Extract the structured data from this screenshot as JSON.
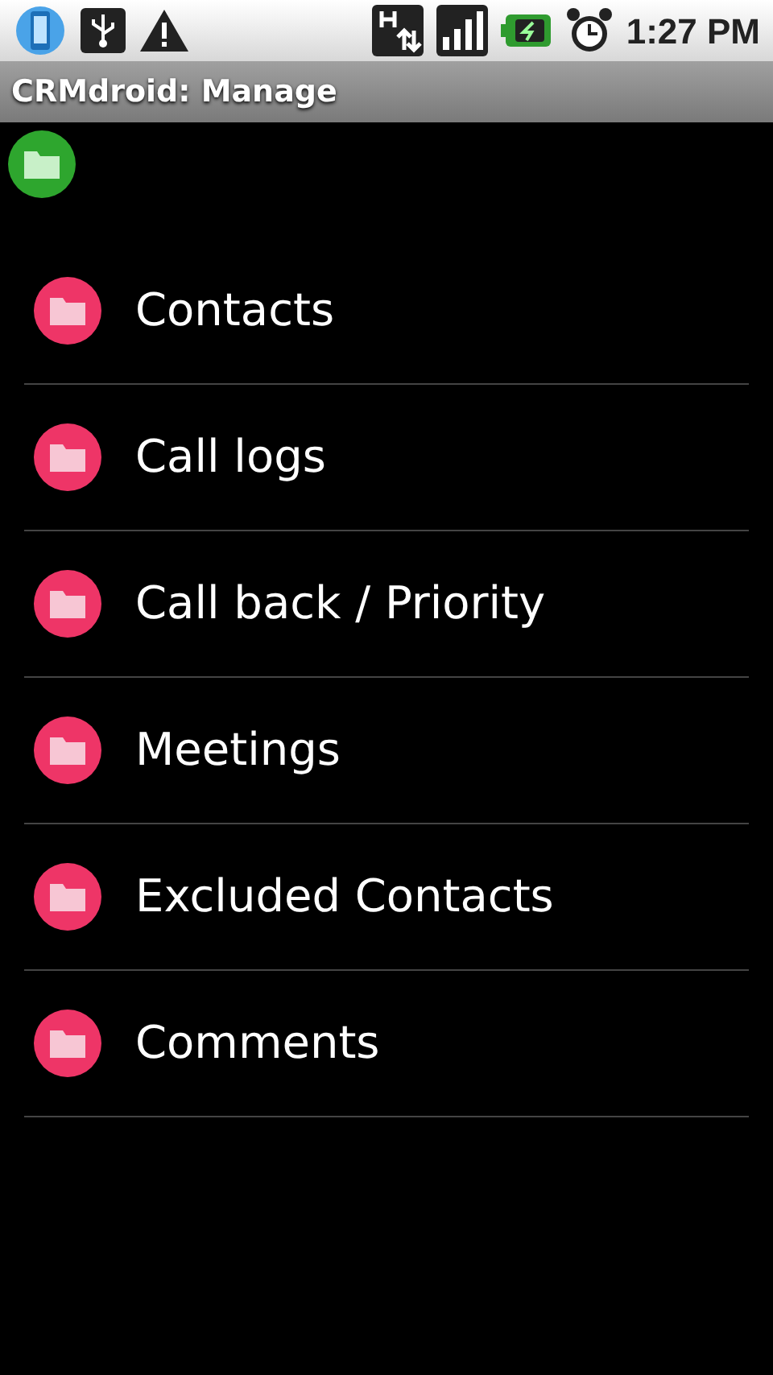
{
  "status_bar": {
    "time": "1:27 PM"
  },
  "window": {
    "title": "CRMdroid: Manage"
  },
  "menu": [
    {
      "label": "Contacts"
    },
    {
      "label": "Call logs"
    },
    {
      "label": "Call back / Priority"
    },
    {
      "label": "Meetings"
    },
    {
      "label": "Excluded Contacts"
    },
    {
      "label": "Comments"
    }
  ]
}
